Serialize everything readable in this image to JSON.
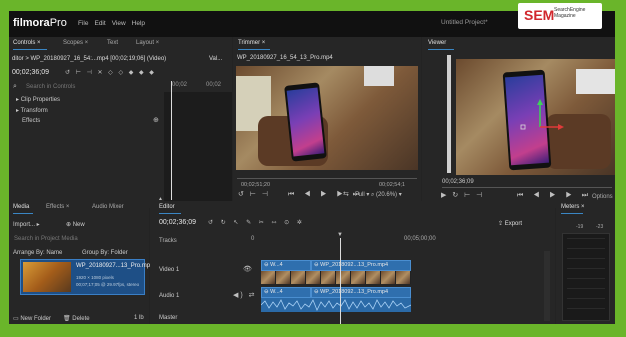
{
  "titlebar": {
    "logo_main": "filmora",
    "logo_pro": "Pro",
    "menu": [
      "File",
      "Edit",
      "View",
      "Help"
    ],
    "project_title": "Untitled Project*"
  },
  "watermark": {
    "big": "SEM",
    "line1": "SearchEngine",
    "line2": "Magazine"
  },
  "controls_panel": {
    "tabs": [
      "Controls",
      "Scopes",
      "Text",
      "Layout"
    ],
    "editor_path": "ditor > WP_20180927_16_54:...mp4 [00;02;19;06] (Video)",
    "val_label": "Val...",
    "timecode": "00;02;36;09",
    "search_placeholder": "Search in Controls",
    "tree": [
      "Clip Properties",
      "Transform",
      "Effects"
    ],
    "ruler_marks": [
      "00;02",
      "00;02"
    ]
  },
  "trimmer": {
    "tab": "Trimmer",
    "clip_name": "WP_20180927_16_54_13_Pro.mp4",
    "time_left": "00;02;51;20",
    "time_right": "00;02;54;1",
    "zoom_mode": "Full",
    "zoom_level": "(20.6%)"
  },
  "viewer": {
    "tab": "Viewer",
    "timecode": "00;02;36;09",
    "options_label": "Options"
  },
  "media_panel": {
    "tabs": [
      "Media",
      "Effects",
      "Audio Mixer"
    ],
    "import_label": "Import...",
    "new_label": "New",
    "search_placeholder": "Search in Project Media",
    "arrange_label": "Arrange By: Name",
    "group_label": "Group By: Folder",
    "item_name": "WP_20180927...13_Pro.mp4",
    "item_res": "1920 × 1080 pixels",
    "item_meta": "00;07;17;05 @ 29.97fps, stereo",
    "new_folder_label": "New Folder",
    "delete_label": "Delete",
    "page_indicator": "1 lb"
  },
  "editor": {
    "tab": "Editor",
    "timecode": "00;02;36;09",
    "export_label": "Export",
    "ruler_start": "0",
    "ruler_mark": "00;05;00;00",
    "tracks_label": "Tracks",
    "video_track": "Video 1",
    "audio_track": "Audio 1",
    "master_track": "Master",
    "clip_a_label": "W...4",
    "clip_b_label": "WP_2018092...13_Pro.mp4",
    "clip_a_audio": "W...4",
    "clip_b_audio": "WP_2018092...13_Pro.mp4"
  },
  "meters": {
    "tab": "Meters",
    "scale": [
      "-19",
      "-23"
    ]
  }
}
